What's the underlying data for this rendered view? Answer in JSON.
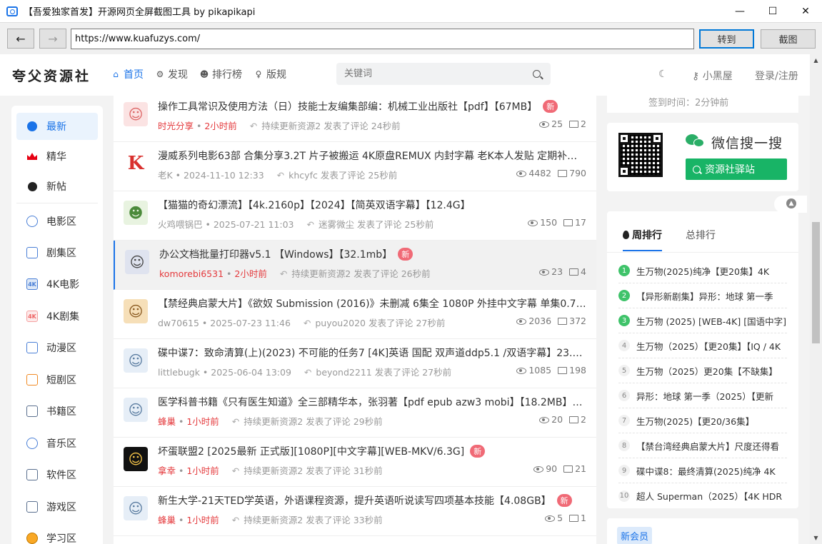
{
  "window": {
    "title": "【吾爱独家首发】开源网页全屏截图工具 by pikapikapi",
    "minimize": "—",
    "maximize": "☐",
    "close": "✕"
  },
  "addressbar": {
    "back": "←",
    "forward": "→",
    "url": "https://www.kuafuzys.com/",
    "go_label": "转到",
    "screenshot_label": "截图"
  },
  "header": {
    "logo": "夸父资源社",
    "nav": [
      {
        "label": "首页",
        "icon": "home-icon"
      },
      {
        "label": "发现",
        "icon": "gear-icon"
      },
      {
        "label": "排行榜",
        "icon": "users-icon"
      },
      {
        "label": "版规",
        "icon": "bulb-icon"
      }
    ],
    "search_placeholder": "关键词",
    "moon": "☾",
    "house_link": "小黑屋",
    "login_link": "登录/注册"
  },
  "sidebar": {
    "items": [
      {
        "label": "最新",
        "icon": "compass-icon"
      },
      {
        "label": "精华",
        "icon": "crown-icon"
      },
      {
        "label": "新帖",
        "icon": "clock-icon"
      },
      {
        "label": "电影区",
        "icon": "film-reel-icon"
      },
      {
        "label": "剧集区",
        "icon": "tv-play-icon"
      },
      {
        "label": "4K电影",
        "icon": "4k-icon"
      },
      {
        "label": "4K剧集",
        "icon": "4k-series-icon"
      },
      {
        "label": "动漫区",
        "icon": "anime-tv-icon"
      },
      {
        "label": "短剧区",
        "icon": "short-play-icon"
      },
      {
        "label": "书籍区",
        "icon": "book-icon"
      },
      {
        "label": "音乐区",
        "icon": "music-icon"
      },
      {
        "label": "软件区",
        "icon": "code-icon"
      },
      {
        "label": "游戏区",
        "icon": "gamepad-icon"
      },
      {
        "label": "学习区",
        "icon": "study-icon"
      }
    ],
    "icon_text_4k": "4K"
  },
  "posts": [
    {
      "title": "操作工具常识及使用方法（日）技能士友编集部编：机械工业出版社【pdf】【67MB】",
      "new": "新",
      "author": "时光分享",
      "time": "2小时前",
      "replier": "持续更新资源2",
      "reply_text": "发表了评论 24秒前",
      "views": "25",
      "comments": "2"
    },
    {
      "title": "漫威系列电影63部 合集分享3.2T 片子被搬运 4K原盘REMUX 内封字幕 老K本人发贴 定期补发被…",
      "new": "",
      "author": "老K",
      "time": "2024-11-10 12:33",
      "replier": "khcyfc",
      "reply_text": "发表了评论 25秒前",
      "views": "4482",
      "comments": "790"
    },
    {
      "title": "【猫猫的奇幻漂流】【4k.2160p】【2024】【简英双语字幕】【12.4G】",
      "new": "",
      "author": "火鸡喂锅巴",
      "time": "2025-07-21 11:03",
      "replier": "迷雾微尘",
      "reply_text": "发表了评论 25秒前",
      "views": "150",
      "comments": "17"
    },
    {
      "title": "办公文档批量打印器v5.1 【Windows】【32.1mb】",
      "new": "新",
      "author": "komorebi6531",
      "time": "2小时前",
      "replier": "持续更新资源2",
      "reply_text": "发表了评论 26秒前",
      "views": "23",
      "comments": "4"
    },
    {
      "title": "【禁经典启蒙大片】《欲奴 Submission (2016)》未删减 6集全 1080P 外挂中文字幕 单集0.7G…",
      "new": "",
      "author": "dw70615",
      "time": "2025-07-23 11:46",
      "replier": "puyou2020",
      "reply_text": "发表了评论 27秒前",
      "views": "2036",
      "comments": "372"
    },
    {
      "title": "碟中谍7：致命清算(上)(2023) 不可能的任务7 [4K]英语 国配 双声道ddp5.1 /双语字幕】23.6G…",
      "new": "",
      "author": "littlebugk",
      "time": "2025-06-04 13:09",
      "replier": "beyond2211",
      "reply_text": "发表了评论 27秒前",
      "views": "1085",
      "comments": "198"
    },
    {
      "title": "医学科普书籍《只有医生知道》全三部精华本，张羽著【pdf epub azw3 mobi】【18.2MB】",
      "new": "新",
      "author": "蜂巢",
      "time": "1小时前",
      "replier": "持续更新资源2",
      "reply_text": "发表了评论 29秒前",
      "views": "20",
      "comments": "2"
    },
    {
      "title": "坏蛋联盟2 [2025最新 正式版][1080P][中文字幕][WEB-MKV/6.3G]",
      "new": "新",
      "author": "拿幸",
      "time": "1小时前",
      "replier": "持续更新资源2",
      "reply_text": "发表了评论 31秒前",
      "views": "90",
      "comments": "21"
    },
    {
      "title": "新生大学-21天TED学英语，外语课程资源，提升英语听说读写四项基本技能【4.08GB】",
      "new": "新",
      "author": "蜂巢",
      "time": "1小时前",
      "replier": "持续更新资源2",
      "reply_text": "发表了评论 33秒前",
      "views": "5",
      "comments": "1"
    }
  ],
  "right": {
    "signin_time": "签到时间：2分钟前",
    "wechat_title": "微信搜一搜",
    "wechat_button": "资源社驿站",
    "rank_tab_week": "周排行",
    "rank_tab_total": "总排行",
    "rank": [
      {
        "n": "1",
        "text": "生万物(2025)纯净【更20集】4K"
      },
      {
        "n": "2",
        "text": "【异形新剧集】异形：地球 第一季"
      },
      {
        "n": "3",
        "text": "生万物 (2025) [WEB-4K] [国语中字]"
      },
      {
        "n": "4",
        "text": "生万物（2025）【更20集】【IQ / 4K"
      },
      {
        "n": "5",
        "text": "生万物（2025）更20集【不缺集】"
      },
      {
        "n": "6",
        "text": "异形：地球 第一季（2025）【更新"
      },
      {
        "n": "7",
        "text": "生万物(2025)【更20/36集】"
      },
      {
        "n": "8",
        "text": "【禁台湾经典启蒙大片】尺度还得看"
      },
      {
        "n": "9",
        "text": "碟中谍8：最终清算(2025)纯净 4K"
      },
      {
        "n": "10",
        "text": "超人 Superman（2025）【4K HDR"
      }
    ],
    "new_member": "新会员"
  },
  "colors": {
    "accent": "#1a73e8",
    "new_badge": "#f06a76",
    "wechat_green": "#18b466",
    "red_meta": "#e4393c"
  }
}
